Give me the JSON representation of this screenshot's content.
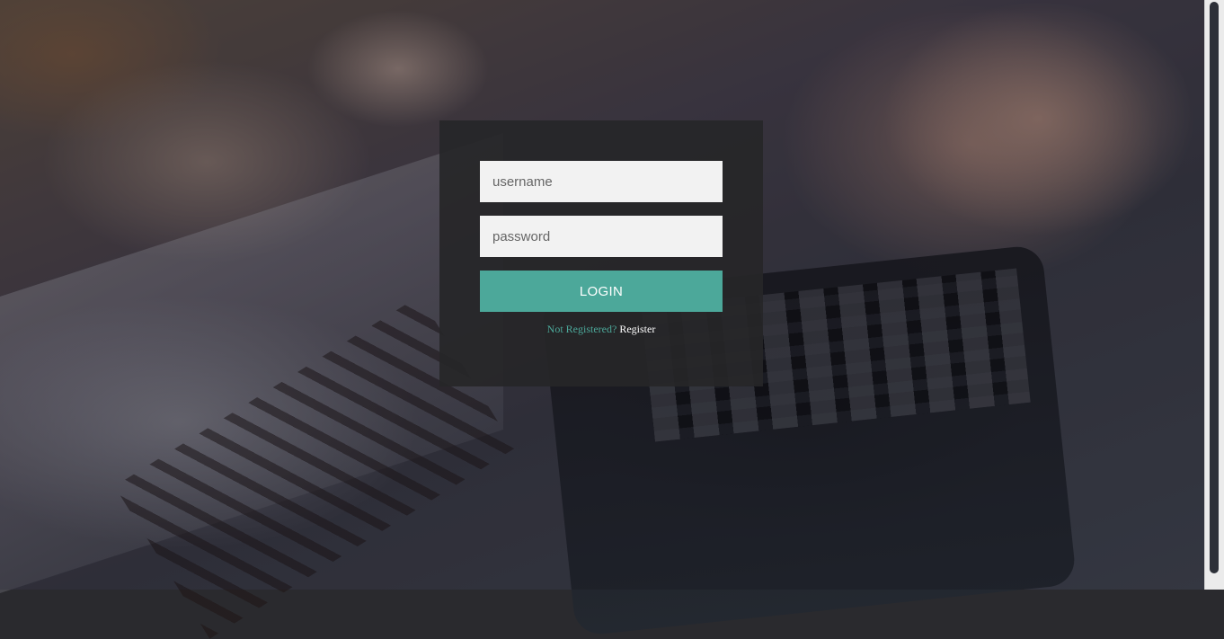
{
  "login_form": {
    "username_placeholder": "username",
    "password_placeholder": "password",
    "login_label": "LOGIN",
    "not_registered_text": "Not Registered?",
    "register_link": "Register"
  },
  "colors": {
    "accent": "#4ca89a",
    "panel": "#262628",
    "field_bg": "#f2f2f2"
  }
}
